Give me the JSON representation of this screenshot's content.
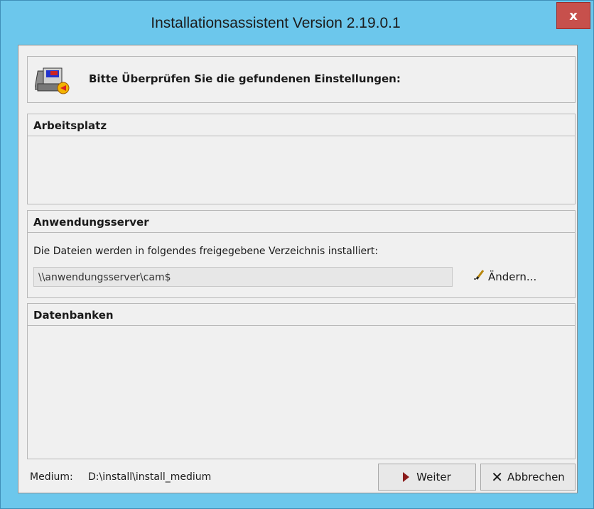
{
  "window": {
    "title": "Installationsassistent  Version 2.19.0.1",
    "close_label": "x"
  },
  "header": {
    "icon": "installer-computer-icon",
    "text": "Bitte Überprüfen Sie die gefundenen Einstellungen:"
  },
  "sections": {
    "arbeitsplatz": {
      "title": "Arbeitsplatz"
    },
    "server": {
      "title": "Anwendungsserver",
      "description": "Die Dateien werden in folgendes freigegebene Verzeichnis installiert:",
      "path": "\\\\anwendungsserver\\cam$",
      "change_label": "Ändern..."
    },
    "datenbanken": {
      "title": "Datenbanken"
    }
  },
  "status": {
    "label": "Medium:",
    "value": "D:\\install\\install_medium"
  },
  "buttons": {
    "next_label": "Weiter",
    "cancel_label": "Abbrechen"
  },
  "colors": {
    "window_frame": "#6cc7ec",
    "close_button": "#c7504c",
    "client_bg": "#f0f0f0"
  }
}
